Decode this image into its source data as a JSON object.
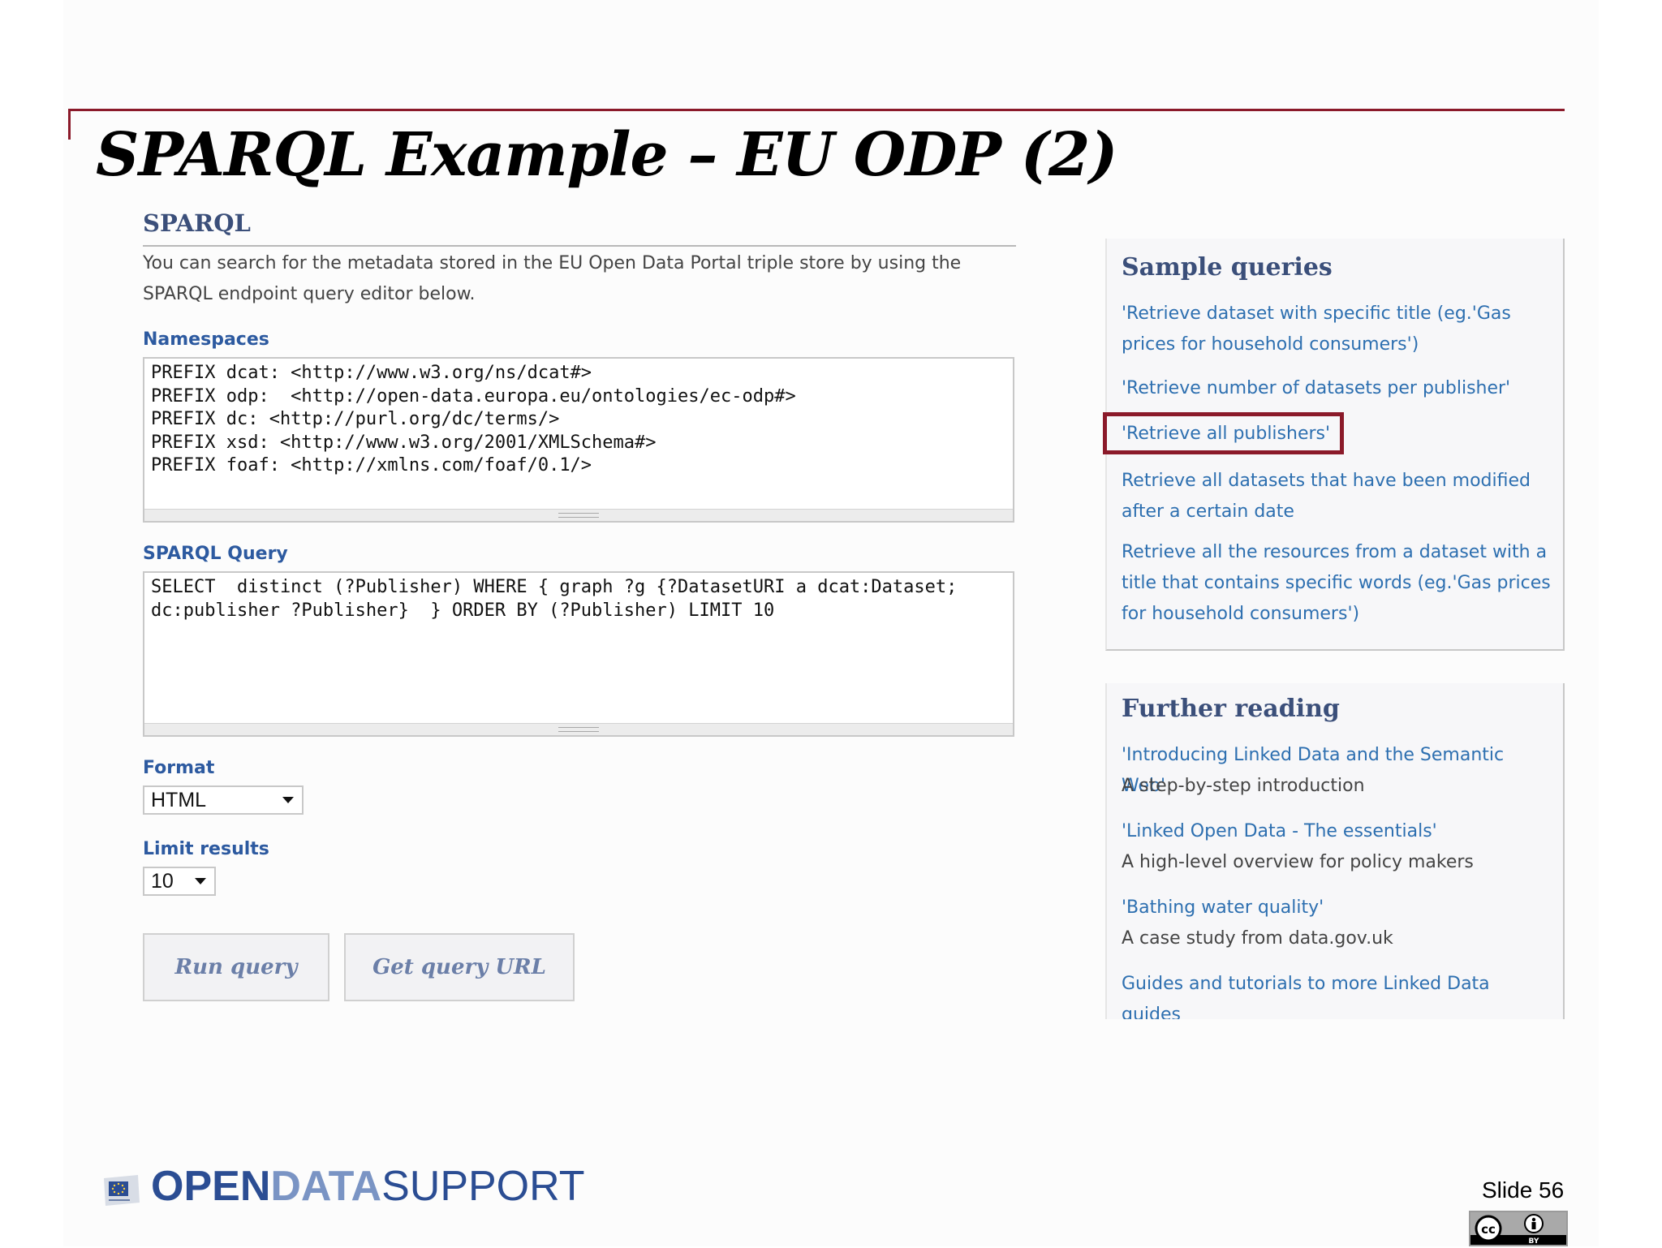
{
  "slide": {
    "title": "SPARQL Example – EU ODP (2)",
    "number_label": "Slide 56"
  },
  "panel": {
    "heading": "SPARQL",
    "intro": "You can search for the metadata stored in the EU Open Data Portal triple store by using the SPARQL endpoint query editor below.",
    "namespaces_label": "Namespaces",
    "namespaces_value": "PREFIX dcat: <http://www.w3.org/ns/dcat#>\nPREFIX odp:  <http://open-data.europa.eu/ontologies/ec-odp#>\nPREFIX dc: <http://purl.org/dc/terms/>\nPREFIX xsd: <http://www.w3.org/2001/XMLSchema#>\nPREFIX foaf: <http://xmlns.com/foaf/0.1/>",
    "query_label": "SPARQL Query",
    "query_value": "SELECT  distinct (?Publisher) WHERE { graph ?g {?DatasetURI a dcat:Dataset; dc:publisher ?Publisher}  } ORDER BY (?Publisher) LIMIT 10",
    "format_label": "Format",
    "format_value": "HTML",
    "limit_label": "Limit results",
    "limit_value": "10",
    "run_button": "Run query",
    "url_button": "Get query URL"
  },
  "sample_queries": {
    "heading": "Sample queries",
    "items": [
      "'Retrieve dataset with specific title (eg.'Gas prices for household consumers')",
      "'Retrieve number of datasets per publisher'",
      "'Retrieve all publishers'",
      "Retrieve all datasets that have been modified after a certain date",
      "Retrieve all the resources from a dataset with a title that contains specific words (eg.'Gas prices for household consumers')"
    ],
    "highlighted_index": 2
  },
  "further_reading": {
    "heading": "Further reading",
    "items": [
      {
        "link": "'Introducing Linked Data and the Semantic Web'",
        "note": "A step-by-step introduction"
      },
      {
        "link": "'Linked Open Data - The essentials'",
        "note": "A high-level overview for policy makers"
      },
      {
        "link": "'Bathing water quality'",
        "note": "A case study from data.gov.uk"
      },
      {
        "link": "Guides and tutorials to more Linked Data guides"
      }
    ]
  },
  "footer": {
    "logo_open": "OPEN",
    "logo_data": "DATA",
    "logo_support": "SUPPORT"
  },
  "colors": {
    "accent": "#8b1a2a",
    "heading": "#3b4f7a",
    "label": "#2d5aa0",
    "link": "#2d6fb0"
  }
}
